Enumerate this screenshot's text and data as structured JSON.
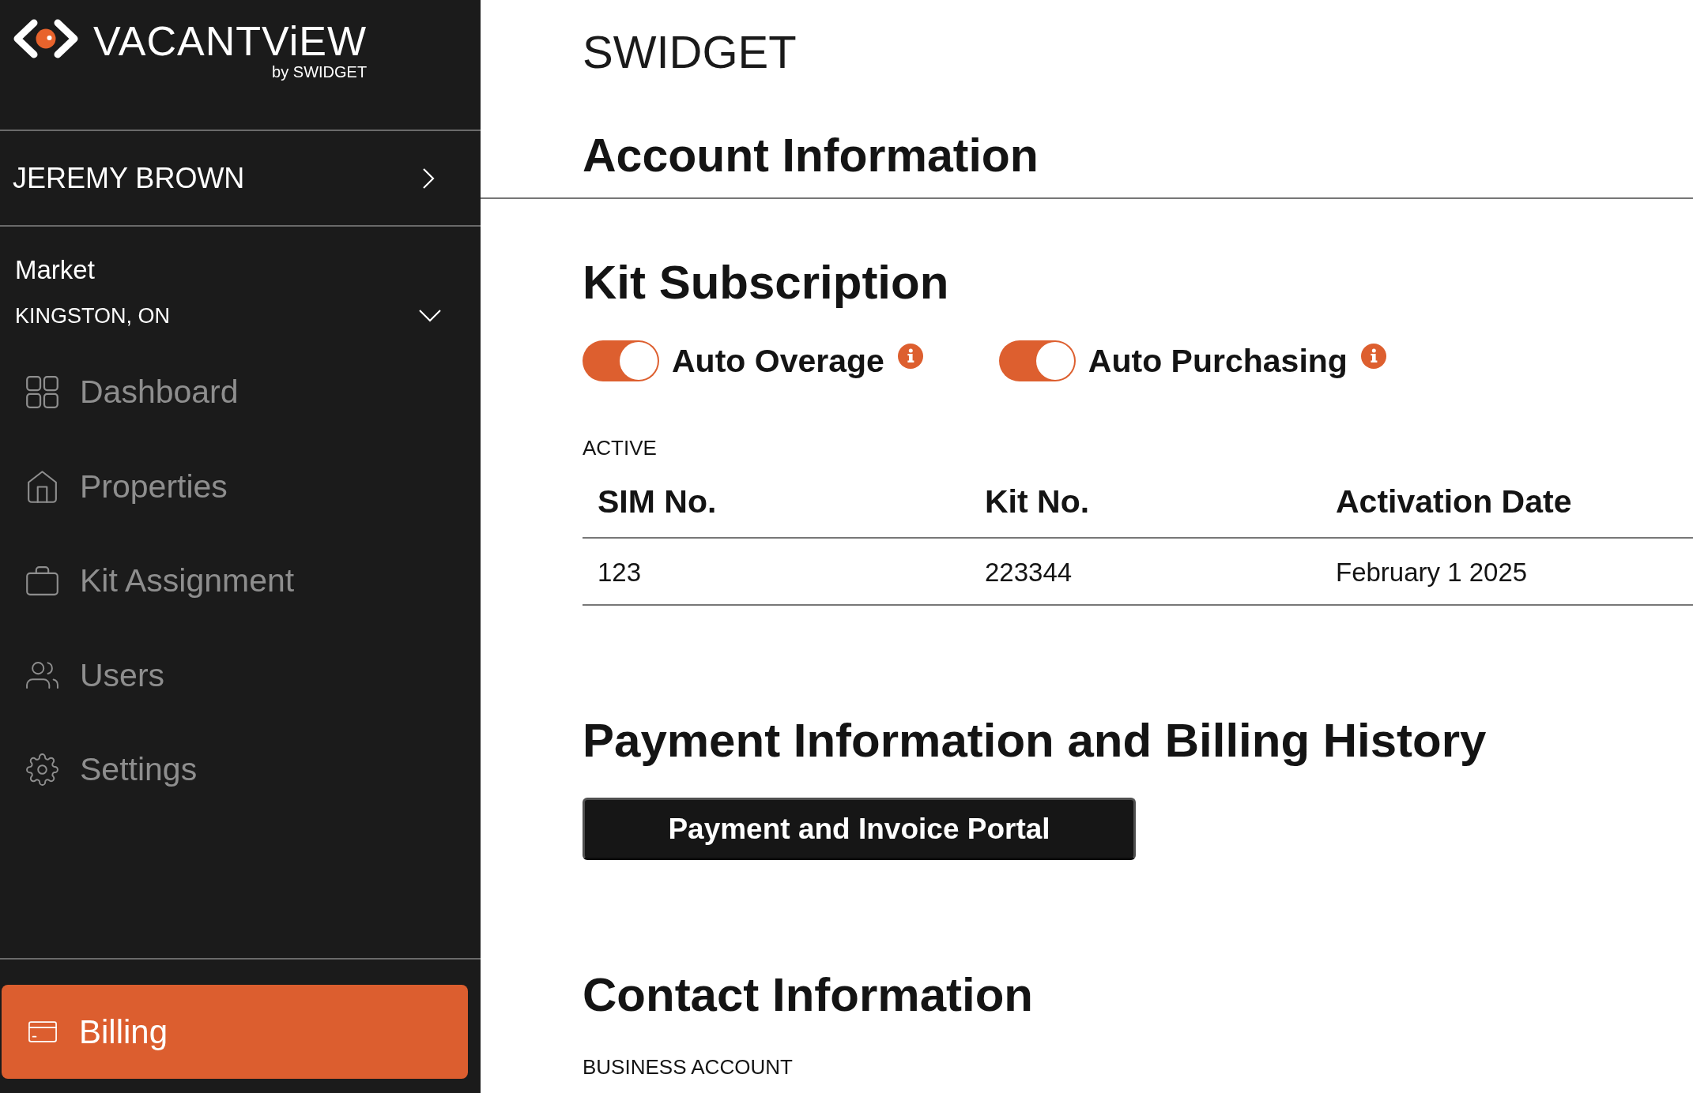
{
  "sidebar": {
    "logo": {
      "wordmark": "VACANTViEW",
      "byline": "by SWIDGET"
    },
    "user": {
      "name": "JEREMY BROWN"
    },
    "market": {
      "label": "Market",
      "value": "KINGSTON, ON"
    },
    "nav_items": [
      {
        "label": "Dashboard",
        "selected": false
      },
      {
        "label": "Properties",
        "selected": false
      },
      {
        "label": "Kit Assignment",
        "selected": false
      },
      {
        "label": "Users",
        "selected": false
      },
      {
        "label": "Settings",
        "selected": false
      }
    ],
    "footer_items": [
      {
        "label": "Billing",
        "selected": true
      }
    ]
  },
  "header": {
    "company": "SWIDGET",
    "title": "Account Information"
  },
  "kit_subscription": {
    "title": "Kit Subscription",
    "toggles": [
      {
        "label": "Auto Overage",
        "on": true
      },
      {
        "label": "Auto Purchasing",
        "on": true
      }
    ],
    "status": "ACTIVE",
    "table": {
      "columns": [
        "SIM No.",
        "Kit No.",
        "Activation Date"
      ],
      "rows": [
        [
          "123",
          "223344",
          "February 1 2025"
        ]
      ]
    }
  },
  "payment": {
    "title": "Payment Information and Billing History",
    "button": "Payment and Invoice Portal"
  },
  "contact": {
    "title": "Contact Information",
    "account_type": "BUSINESS ACCOUNT"
  }
}
